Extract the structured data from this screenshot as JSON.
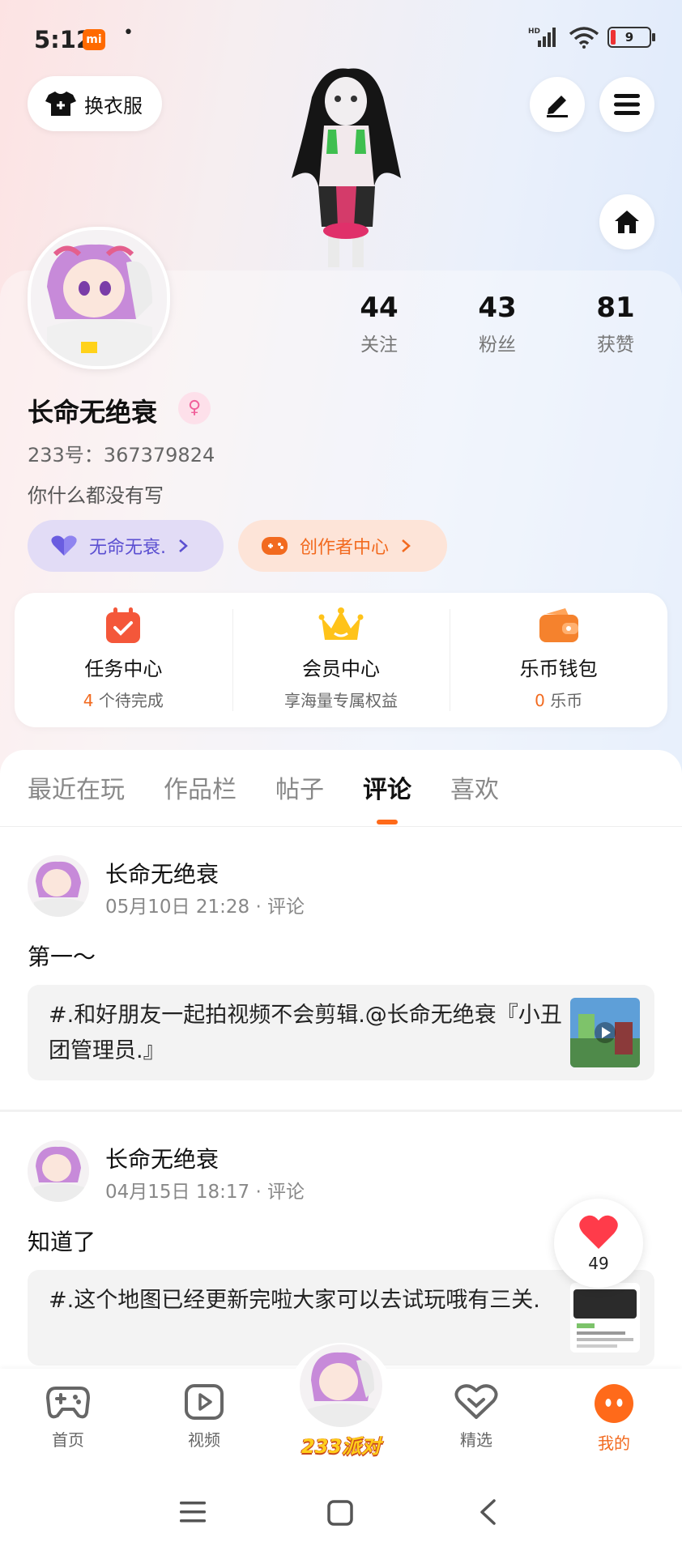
{
  "status_bar": {
    "time": "5:12",
    "mi_badge": "mi",
    "dot": "•",
    "battery": "9",
    "signal_label": "HD"
  },
  "header": {
    "outfit_button": "换衣服"
  },
  "profile": {
    "name": "长命无绝衰",
    "gender_symbol": "♀",
    "uid": "233号：367379824",
    "bio": "你什么都没有写",
    "stats": [
      {
        "num": "44",
        "label": "关注"
      },
      {
        "num": "43",
        "label": "粉丝"
      },
      {
        "num": "81",
        "label": "获赞"
      }
    ],
    "tags": [
      {
        "label": "无命无衰."
      },
      {
        "label": "创作者中心"
      }
    ]
  },
  "quick": [
    {
      "title": "任务中心",
      "highlight": "4",
      "sub": " 个待完成"
    },
    {
      "title": "会员中心",
      "highlight": "",
      "sub": "享海量专属权益"
    },
    {
      "title": "乐币钱包",
      "highlight": "0",
      "sub": " 乐币"
    }
  ],
  "tabs": [
    "最近在玩",
    "作品栏",
    "帖子",
    "评论",
    "喜欢"
  ],
  "active_tab": "评论",
  "comments": [
    {
      "name": "长命无绝衰",
      "meta": "05月10日 21:28 · 评论",
      "text": "第一～",
      "quote": "#.和好朋友一起拍视频不会剪辑.@长命无绝衰『小丑团管理员.』"
    },
    {
      "name": "长命无绝衰",
      "meta": "04月15日 18:17 · 评论",
      "text": "知道了",
      "quote": "#.这个地图已经更新完啦大家可以去试玩哦有三关."
    }
  ],
  "like_float": {
    "count": "49"
  },
  "bottom_nav": {
    "items": [
      {
        "label": "首页"
      },
      {
        "label": "视频"
      },
      {
        "label": "精选"
      },
      {
        "label": "我的"
      }
    ],
    "center_logo": "233派对"
  },
  "colors": {
    "accent": "#ff6a1a",
    "purple": "#5b4fd1"
  }
}
